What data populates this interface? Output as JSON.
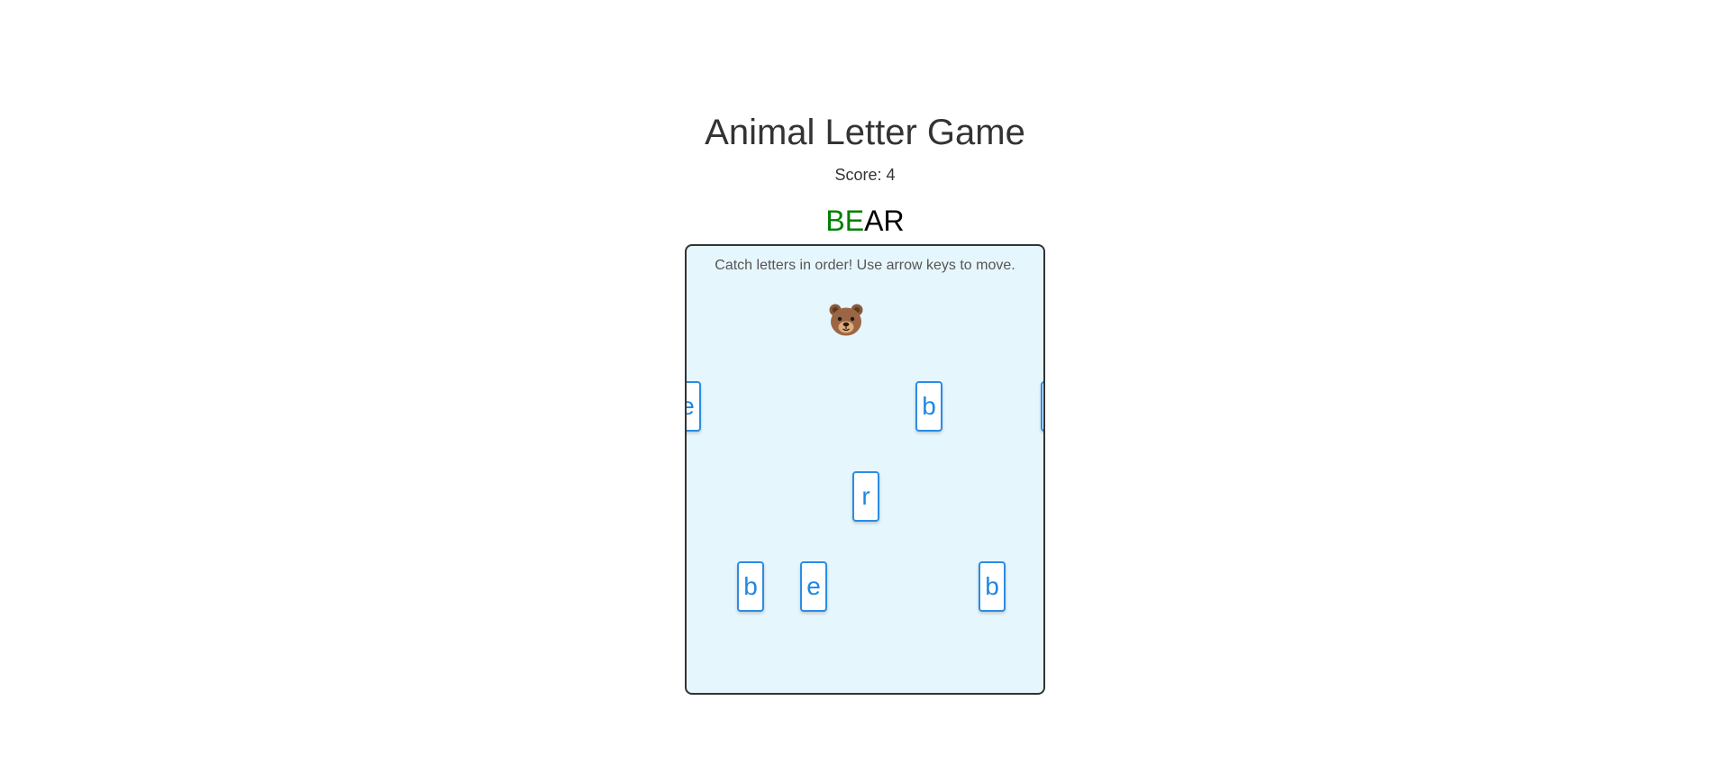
{
  "title": "Animal Letter Game",
  "score_text": "Score: 4",
  "target_word": {
    "caught": "BE",
    "remaining": "AR"
  },
  "instructions": "Catch letters in order! Use arrow keys to move.",
  "player": {
    "icon": "bear-face-icon"
  },
  "letters": [
    "e",
    "b",
    "",
    "r",
    "b",
    "e",
    "b"
  ],
  "colors": {
    "caught": "#008000",
    "remaining": "#000000",
    "board_bg": "#e6f6fd",
    "letter_text": "#1e88e5",
    "letter_border": "#2a8ce6"
  }
}
